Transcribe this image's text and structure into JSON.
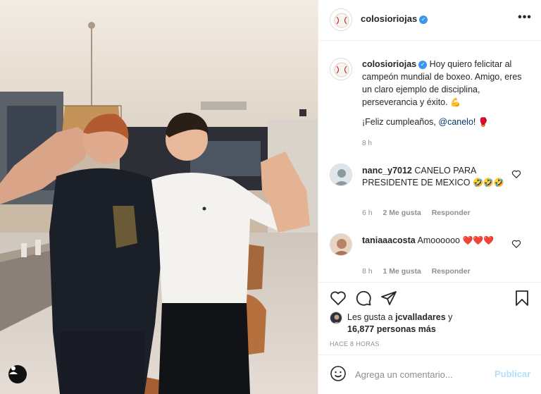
{
  "post": {
    "author": "colosioriojas",
    "verified": true,
    "more_label": "•••"
  },
  "caption": {
    "username": "colosioriojas",
    "text": "Hoy quiero felicitar al campeón mundial de boxeo. Amigo, eres un claro ejemplo de disciplina, perseverancia y éxito.",
    "emoji_1": "💪",
    "bday_prefix": "¡Feliz cumpleaños, ",
    "mention": "@canelo",
    "bday_suffix": "!",
    "emoji_2": "🥊",
    "time": "8 h"
  },
  "comments": [
    {
      "username": "nanc_y7012",
      "text": "CANELO PARA PRESIDENTE DE MEXICO",
      "emoji": "🤣🤣🤣",
      "time": "6 h",
      "likes": "2 Me gusta",
      "reply": "Responder"
    },
    {
      "username": "taniaaacosta",
      "text": "Amoooooo",
      "emoji": "❤️❤️❤️",
      "time": "8 h",
      "likes": "1 Me gusta",
      "reply": "Responder"
    }
  ],
  "likes": {
    "prefix": "Les gusta a ",
    "user": "jcvalladares",
    "middle": " y",
    "count": "16,877 personas más"
  },
  "time_ago": "HACE 8 HORAS",
  "comment_box": {
    "placeholder": "Agrega un comentario...",
    "post_label": "Publicar"
  },
  "icons": {
    "like": "heart-icon",
    "comment": "comment-icon",
    "share": "share-icon",
    "save": "bookmark-icon",
    "emoji": "smiley-icon",
    "tag": "user-tag-icon"
  },
  "colors": {
    "verified": "#3897f0",
    "mention": "#00376b",
    "secondary_text": "#8e8e8e",
    "post_button_disabled": "#b2dffc"
  }
}
